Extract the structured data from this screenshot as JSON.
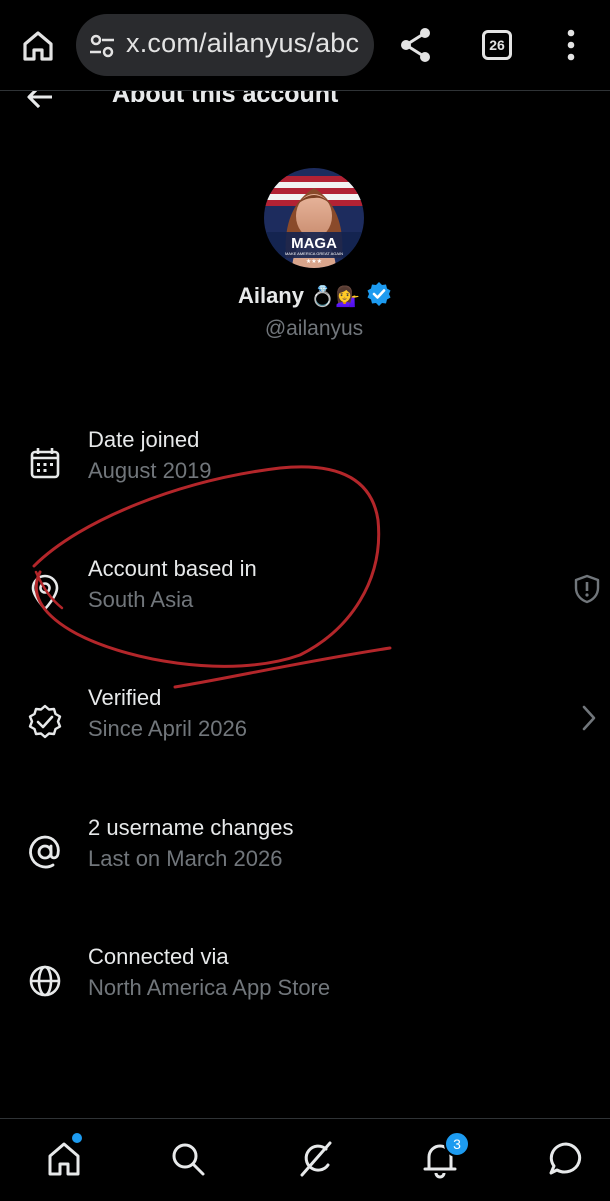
{
  "browser": {
    "url": "x.com/ailanyus/abc",
    "tab_count": "26",
    "icons": [
      "home-icon",
      "tune-icon",
      "share-icon",
      "tabs-icon",
      "more-vert-icon"
    ]
  },
  "header": {
    "title": "About this account",
    "back_icon": "arrow-left-icon"
  },
  "profile": {
    "display_name": "Ailany",
    "name_emojis": "💍💁‍♀️",
    "handle": "@ailanyus",
    "verified": true,
    "avatar_text": "MAGA",
    "avatar_subtext": "MAKE AMERICA GREAT AGAIN"
  },
  "rows": [
    {
      "icon": "calendar-icon",
      "title": "Date joined",
      "subtitle": "August 2019"
    },
    {
      "icon": "location-pin-icon",
      "title": "Account based in",
      "subtitle": "South Asia",
      "right_icon": "shield-alert-icon"
    },
    {
      "icon": "verified-check-icon",
      "title": "Verified",
      "subtitle": "Since April 2026",
      "right_icon": "chevron-right-icon"
    },
    {
      "icon": "at-sign-icon",
      "title": "2 username changes",
      "subtitle": "Last on March 2026"
    },
    {
      "icon": "globe-icon",
      "title": "Connected via",
      "subtitle": "North America App Store"
    }
  ],
  "bottom_nav": {
    "items": [
      "home-icon",
      "search-icon",
      "grok-icon",
      "notifications-icon",
      "messages-icon"
    ],
    "notification_count": "3"
  },
  "colors": {
    "background": "#000000",
    "primary_text": "#e7e9ea",
    "secondary_text": "#71767b",
    "accent": "#1d9bf0",
    "annotation": "#b3262a"
  }
}
